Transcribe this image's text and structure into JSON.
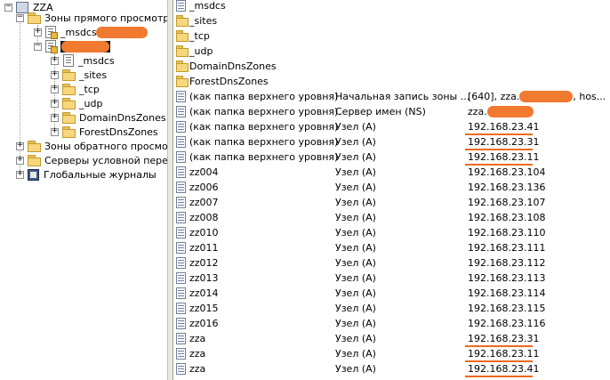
{
  "tree": {
    "root": "ZZA",
    "forward_zones": "Зоны прямого просмотра",
    "msdcs_zone": "_msdcs.",
    "sub": [
      "_msdcs",
      "_sites",
      "_tcp",
      "_udp",
      "DomainDnsZones",
      "ForestDnsZones"
    ],
    "reverse_zones": "Зоны обратного просмотр",
    "conditional": "Серверы условной пересь",
    "global_logs": "Глобальные журналы",
    "expander_minus": "−",
    "expander_plus": "+"
  },
  "list": {
    "folders": [
      "_msdcs",
      "_sites",
      "_tcp",
      "_udp",
      "DomainDnsZones",
      "ForestDnsZones"
    ],
    "records": [
      {
        "name": "(как папка верхнего уровня)",
        "type": "Начальная запись зоны ...",
        "data": "[640], zza.",
        "data_tail": ", hos..."
      },
      {
        "name": "(как папка верхнего уровня)",
        "type": "Сервер имен (NS)",
        "data": "zza."
      },
      {
        "name": "(как папка верхнего уровня)",
        "type": "Узел (A)",
        "data": "192.168.23.41"
      },
      {
        "name": "(как папка верхнего уровня)",
        "type": "Узел (A)",
        "data": "192.168.23.31"
      },
      {
        "name": "(как папка верхнего уровня)",
        "type": "Узел (A)",
        "data": "192.168.23.11"
      },
      {
        "name": "zz004",
        "type": "Узел (A)",
        "data": "192.168.23.104"
      },
      {
        "name": "zz006",
        "type": "Узел (A)",
        "data": "192.168.23.136"
      },
      {
        "name": "zz007",
        "type": "Узел (A)",
        "data": "192.168.23.107"
      },
      {
        "name": "zz008",
        "type": "Узел (A)",
        "data": "192.168.23.108"
      },
      {
        "name": "zz010",
        "type": "Узел (A)",
        "data": "192.168.23.110"
      },
      {
        "name": "zz011",
        "type": "Узел (A)",
        "data": "192.168.23.111"
      },
      {
        "name": "zz012",
        "type": "Узел (A)",
        "data": "192.168.23.112"
      },
      {
        "name": "zz013",
        "type": "Узел (A)",
        "data": "192.168.23.113"
      },
      {
        "name": "zz014",
        "type": "Узел (A)",
        "data": "192.168.23.114"
      },
      {
        "name": "zz015",
        "type": "Узел (A)",
        "data": "192.168.23.115"
      },
      {
        "name": "zz016",
        "type": "Узел (A)",
        "data": "192.168.23.116"
      },
      {
        "name": "zza",
        "type": "Узел (A)",
        "data": "192.168.23.31"
      },
      {
        "name": "zza",
        "type": "Узел (A)",
        "data": "192.168.23.11"
      },
      {
        "name": "zza",
        "type": "Узел (A)",
        "data": "192.168.23.41"
      }
    ],
    "highlight_color": "#ef6a20",
    "redaction_color": "#f07a30"
  }
}
